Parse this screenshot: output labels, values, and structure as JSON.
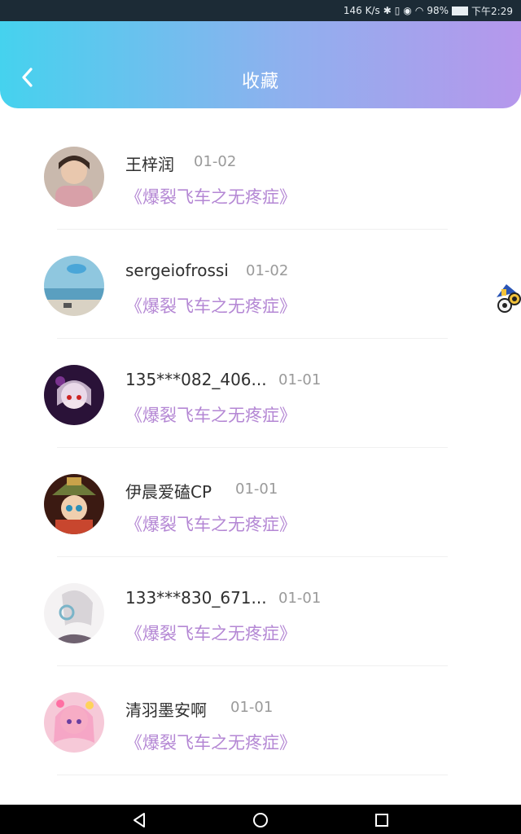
{
  "status_bar": {
    "speed": "146 K/s",
    "battery": "98%",
    "time": "下午2:29"
  },
  "header": {
    "title": "收藏"
  },
  "favorites": [
    {
      "name": "王梓润",
      "date": "01-02",
      "book": "《爆裂飞车之无疼症》"
    },
    {
      "name": "sergeiofrossi",
      "date": "01-02",
      "book": "《爆裂飞车之无疼症》"
    },
    {
      "name": "135***082_406...",
      "date": "01-01",
      "book": "《爆裂飞车之无疼症》"
    },
    {
      "name": "伊晨爱磕CP",
      "date": "01-01",
      "book": "《爆裂飞车之无疼症》"
    },
    {
      "name": "133***830_671...",
      "date": "01-01",
      "book": "《爆裂飞车之无疼症》"
    },
    {
      "name": "清羽墨安啊",
      "date": "01-01",
      "book": "《爆裂飞车之无疼症》"
    }
  ],
  "colors": {
    "header_start": "#45d2ee",
    "header_end": "#b697ec",
    "book_title": "#b487d4"
  },
  "icons": [
    "back-arrow-icon",
    "floating-action-icon",
    "back-nav-icon",
    "home-nav-icon",
    "recents-nav-icon"
  ]
}
